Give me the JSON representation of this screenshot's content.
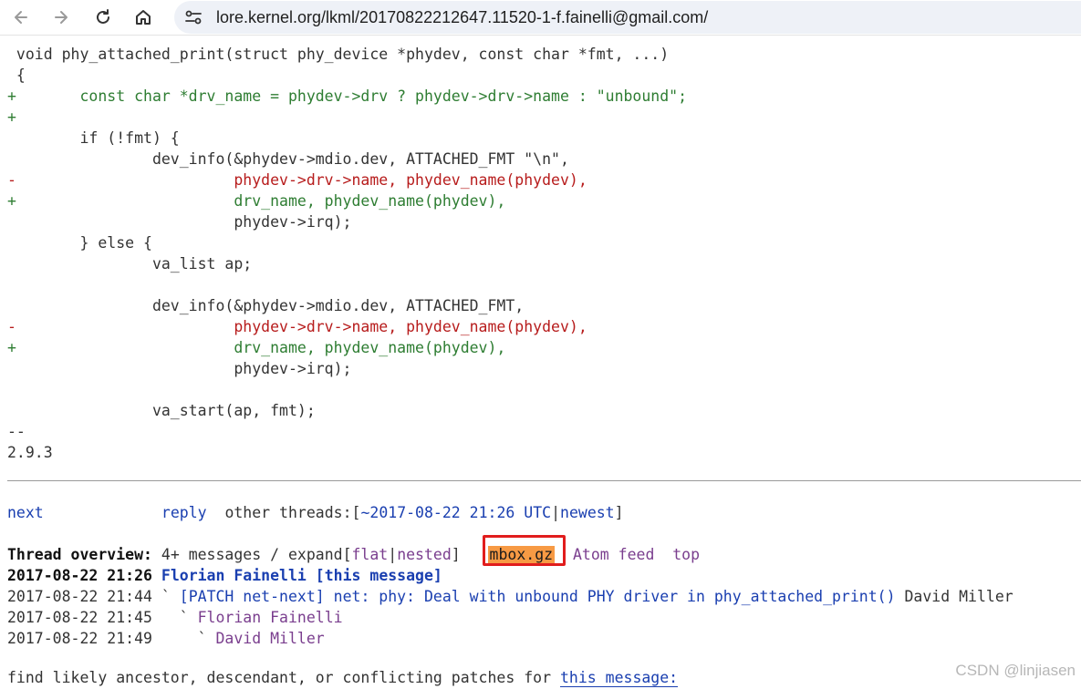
{
  "browser": {
    "url": "lore.kernel.org/lkml/20170822212647.11520-1-f.fainelli@gmail.com/"
  },
  "code": [
    {
      "t": "ctx",
      "text": " void phy_attached_print(struct phy_device *phydev, const char *fmt, ...)"
    },
    {
      "t": "ctx",
      "text": " {"
    },
    {
      "t": "add",
      "text": "+       const char *drv_name = phydev->drv ? phydev->drv->name : \"unbound\";"
    },
    {
      "t": "add",
      "text": "+"
    },
    {
      "t": "ctx",
      "text": "        if (!fmt) {"
    },
    {
      "t": "ctx",
      "text": "                dev_info(&phydev->mdio.dev, ATTACHED_FMT \"\\n\","
    },
    {
      "t": "del",
      "text": "-                        phydev->drv->name, phydev_name(phydev),"
    },
    {
      "t": "add",
      "text": "+                        drv_name, phydev_name(phydev),"
    },
    {
      "t": "ctx",
      "text": "                         phydev->irq);"
    },
    {
      "t": "ctx",
      "text": "        } else {"
    },
    {
      "t": "ctx",
      "text": "                va_list ap;"
    },
    {
      "t": "ctx",
      "text": ""
    },
    {
      "t": "ctx",
      "text": "                dev_info(&phydev->mdio.dev, ATTACHED_FMT,"
    },
    {
      "t": "del",
      "text": "-                        phydev->drv->name, phydev_name(phydev),"
    },
    {
      "t": "add",
      "text": "+                        drv_name, phydev_name(phydev),"
    },
    {
      "t": "ctx",
      "text": "                         phydev->irq);"
    },
    {
      "t": "ctx",
      "text": ""
    },
    {
      "t": "ctx",
      "text": "                va_start(ap, fmt);"
    },
    {
      "t": "plain",
      "text": "--"
    },
    {
      "t": "plain",
      "text": "2.9.3"
    }
  ],
  "nav": {
    "next": "next",
    "reply": "reply",
    "other_threads": "other threads:[",
    "thread_date": "~2017-08-22 21:26 UTC",
    "sep": "|",
    "newest": "newest",
    "close": "]"
  },
  "overview": {
    "label": "Thread overview:",
    "count": " 4+ messages / expand[",
    "flat": "flat",
    "nested": "nested",
    "close": "] ",
    "mbox": "mbox.gz",
    "atom": "Atom feed",
    "top": "top"
  },
  "thread": [
    {
      "date": "2017-08-22 21:26",
      "prefix": " ",
      "author": "Florian Fainelli",
      "subject": "[this message]",
      "tail": "",
      "bold": true
    },
    {
      "date": "2017-08-22 21:44",
      "prefix": " ` ",
      "author": "",
      "subject": "[PATCH net-next] net: phy: Deal with unbound PHY driver in phy_attached_print()",
      "tail": " David Miller",
      "bold": false
    },
    {
      "date": "2017-08-22 21:45",
      "prefix": "   ` ",
      "author": "Florian Fainelli",
      "subject": "",
      "tail": "",
      "bold": false
    },
    {
      "date": "2017-08-22 21:49",
      "prefix": "     ` ",
      "author": "David Miller",
      "subject": "",
      "tail": "",
      "bold": false
    }
  ],
  "footer": {
    "text": "find likely ancestor, descendant, or conflicting patches for ",
    "link": "this message:"
  },
  "watermark": "CSDN @linjiasen"
}
